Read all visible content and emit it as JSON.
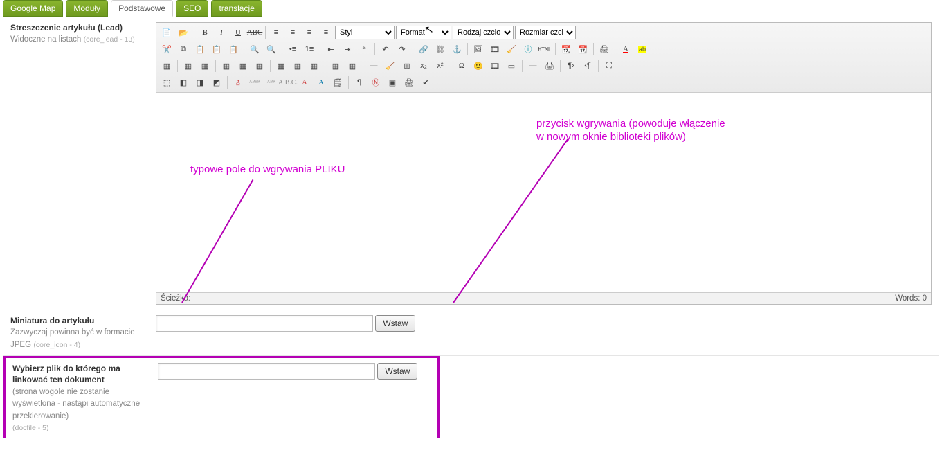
{
  "tabs": [
    "Google Map",
    "Moduły",
    "Podstawowe",
    "SEO",
    "translacje"
  ],
  "active_tab_index": 2,
  "lead_field": {
    "label": "Streszczenie artykułu (Lead)",
    "sub": "Widoczne na listach",
    "tech": "(core_lead - 13)"
  },
  "rte": {
    "style_sel": "Styl",
    "format_sel": "Format",
    "font_sel": "Rodzaj czcionki",
    "size_sel": "Rozmiar czcionki",
    "html_label": "HTML",
    "status_path_label": "Ścieżka:",
    "status_words": "Words: 0"
  },
  "thumb_field": {
    "label": "Miniatura do artykułu",
    "sub": "Zazwyczaj powinna być w formacie JPEG",
    "tech": "(core_icon - 4)",
    "value": "",
    "button": "Wstaw"
  },
  "file_field": {
    "label": "Wybierz plik do którego ma linkować ten dokument",
    "sub": "(strona wogole nie zostanie wyświetlona - nastąpi automatyczne przekierowanie)",
    "tech": "(docfile - 5)",
    "value": "",
    "button": "Wstaw"
  },
  "annotations": {
    "field_note": "typowe pole do wgrywania PLIKU",
    "button_note_l1": "przycisk wgrywania (powoduje włączenie",
    "button_note_l2": "w nowym oknie biblioteki plików)"
  }
}
